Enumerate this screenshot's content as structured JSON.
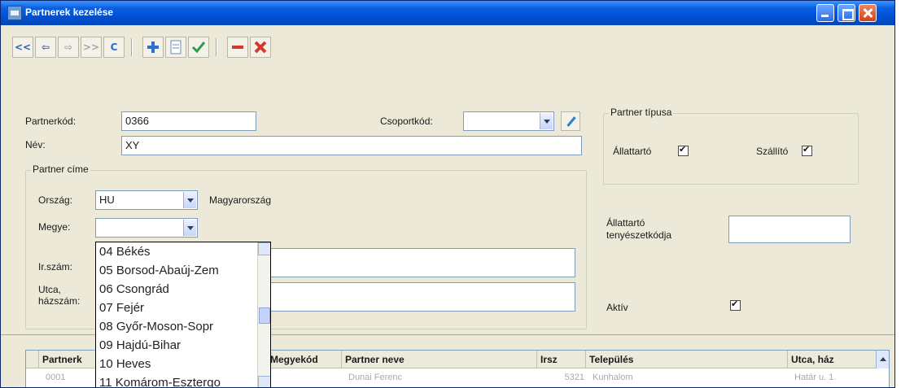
{
  "window": {
    "title": "Partnerek kezelése"
  },
  "toolbar": {
    "first": "<<",
    "prev": "⇦",
    "next": "⇨",
    "last": ">>",
    "refresh": "C",
    "icons": [
      "first-record-icon",
      "prev-record-icon",
      "next-record-icon",
      "last-record-icon",
      "refresh-icon",
      "insert-icon",
      "edit-icon",
      "post-icon",
      "delete-icon",
      "cancel-icon"
    ]
  },
  "form": {
    "partnerkod_label": "Partnerkód:",
    "partnerkod_value": "0366",
    "csoportkod_label": "Csoportkód:",
    "csoportkod_value": "",
    "nev_label": "Név:",
    "nev_value": "XY",
    "partner_cime_legend": "Partner címe",
    "orszag_label": "Ország:",
    "orszag_value": "HU",
    "orszag_name": "Magyarország",
    "megye_label": "Megye:",
    "megye_value": "",
    "irszam_label": "Ir.szám:",
    "utca_label": "Utca, házszám:",
    "partner_tipusa_legend": "Partner típusa",
    "allattarto_label": "Állattartó",
    "szallito_label": "Szállító",
    "allattarto_kod_label": "Állattartó tenyészetkódja",
    "allattarto_kod_value": "",
    "aktiv_label": "Aktív"
  },
  "megye_dropdown": {
    "options": [
      "04 Békés",
      "05 Borsod-Abaúj-Zem",
      "06 Csongrád",
      "07 Fejér",
      "08 Győr-Moson-Sopr",
      "09 Hajdú-Bihar",
      "10 Heves",
      "11 Komárom-Esztergo"
    ]
  },
  "grid": {
    "columns": [
      "Partnerk",
      "Megyekód",
      "Partner neve",
      "Irsz",
      "Település",
      "Utca, ház"
    ],
    "rows": [
      [
        "0001",
        "",
        "Dunai Ferenc",
        "5321",
        "Kunhalom",
        "Határ u. 1."
      ]
    ]
  },
  "colors": {
    "titlebar": "#0052d8",
    "window_bg": "#ece9d8"
  }
}
